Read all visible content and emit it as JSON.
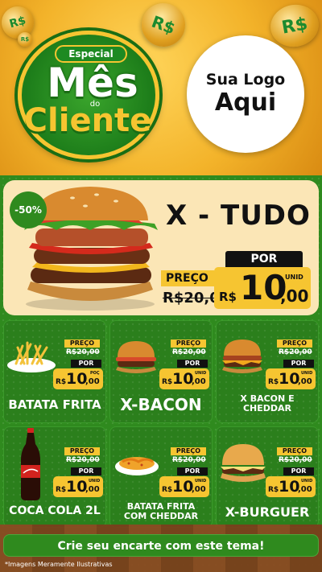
{
  "header": {
    "coin_symbol": "R$",
    "emblem": {
      "especial": "Especial",
      "mes": "Mês",
      "do": "do",
      "cliente": "Cliente"
    },
    "logo": {
      "line1": "Sua Logo",
      "line2": "Aqui"
    }
  },
  "featured": {
    "discount": "-50%",
    "title": "X - TUDO",
    "preco_label": "PREÇO",
    "old_price": "R$20,00",
    "por_label": "POR",
    "currency": "R$",
    "price_int": "10",
    "price_dec": ",00",
    "unit": "UNID"
  },
  "products": [
    {
      "name": "BATATA FRITA",
      "preco_label": "PREÇO",
      "old_price": "R$20,00",
      "por_label": "POR",
      "currency": "R$",
      "price_int": "10",
      "price_dec": ",00",
      "unit": "POÇ"
    },
    {
      "name": "X-BACON",
      "preco_label": "PREÇO",
      "old_price": "R$20,00",
      "por_label": "POR",
      "currency": "R$",
      "price_int": "10",
      "price_dec": ",00",
      "unit": "UNID"
    },
    {
      "name": "X BACON E CHEDDAR",
      "preco_label": "PREÇO",
      "old_price": "R$20,00",
      "por_label": "POR",
      "currency": "R$",
      "price_int": "10",
      "price_dec": ",00",
      "unit": "UNID"
    },
    {
      "name": "COCA COLA 2L",
      "preco_label": "PREÇO",
      "old_price": "R$20,00",
      "por_label": "POR",
      "currency": "R$",
      "price_int": "10",
      "price_dec": ",00",
      "unit": "UNID"
    },
    {
      "name": "BATATA FRITA COM CHEDDAR",
      "preco_label": "PREÇO",
      "old_price": "R$20,00",
      "por_label": "POR",
      "currency": "R$",
      "price_int": "10",
      "price_dec": ",00",
      "unit": "UNID"
    },
    {
      "name": "X-BURGUER",
      "preco_label": "PREÇO",
      "old_price": "R$20,00",
      "por_label": "POR",
      "currency": "R$",
      "price_int": "10",
      "price_dec": ",00",
      "unit": "UNID"
    }
  ],
  "footer": {
    "cta": "Crie seu encarte com este tema!",
    "note": "*Imagens Meramente Ilustrativas"
  },
  "colors": {
    "green": "#2f8a1e",
    "yellow": "#f6c531",
    "cream": "#fbe6b6",
    "dark": "#111111"
  }
}
